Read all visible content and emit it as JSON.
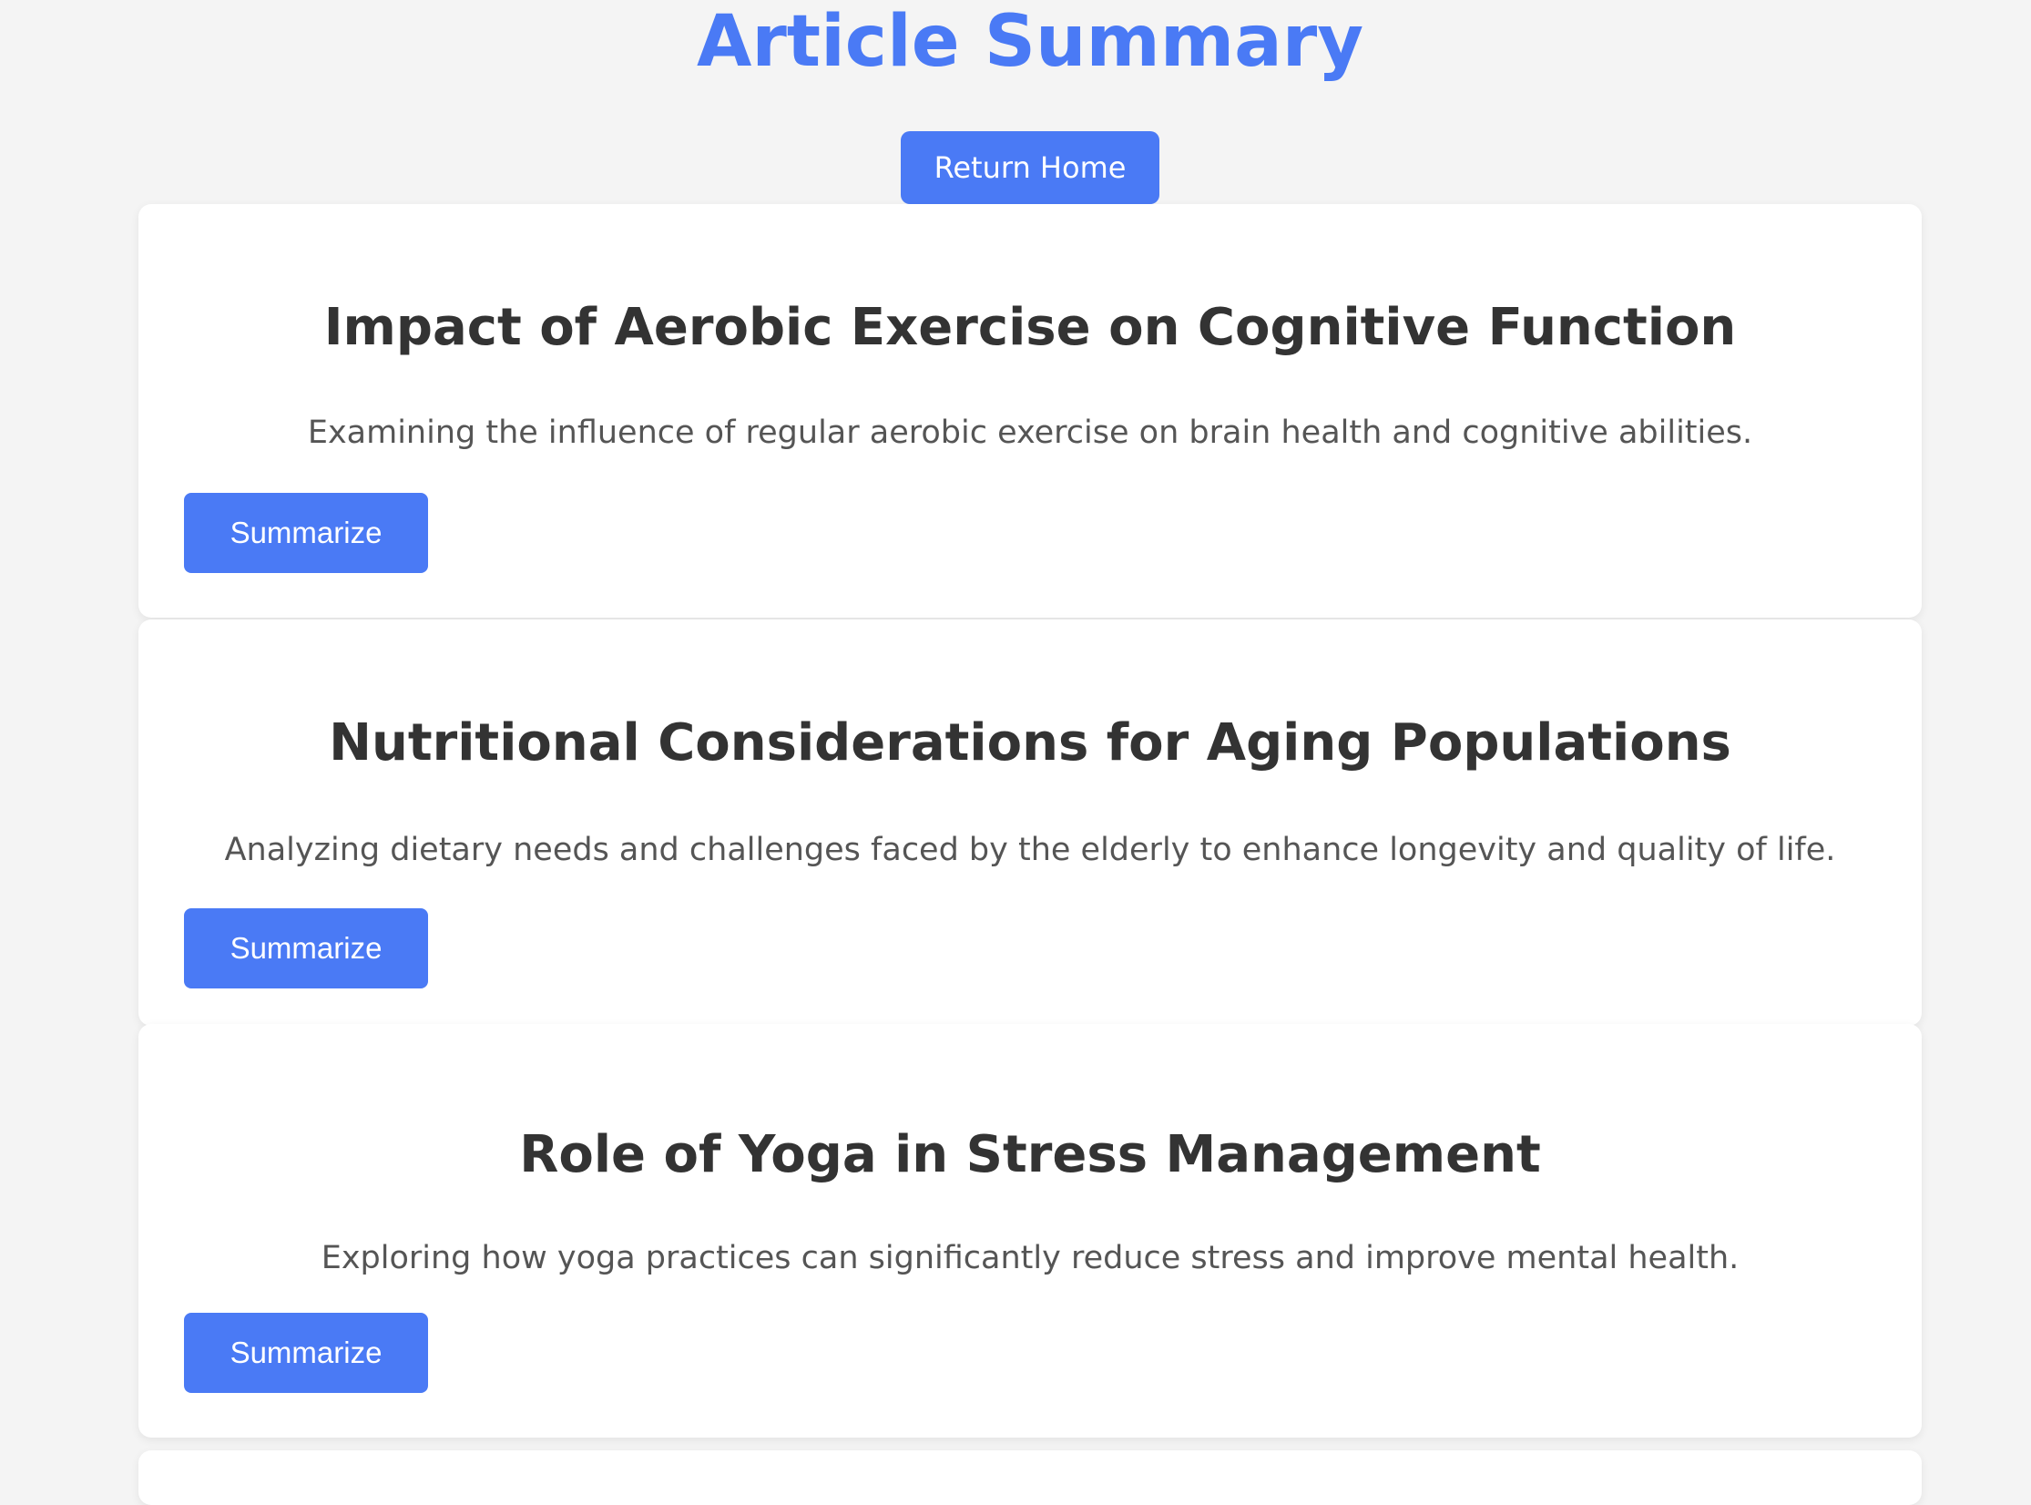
{
  "page": {
    "title": "Article Summary",
    "home_button_label": "Return Home"
  },
  "articles": [
    {
      "title": "Impact of Aerobic Exercise on Cognitive Function",
      "description": "Examining the influence of regular aerobic exercise on brain health and cognitive abilities.",
      "button_label": "Summarize"
    },
    {
      "title": "Nutritional Considerations for Aging Populations",
      "description": "Analyzing dietary needs and challenges faced by the elderly to enhance longevity and quality of life.",
      "button_label": "Summarize"
    },
    {
      "title": "Role of Yoga in Stress Management",
      "description": "Exploring how yoga practices can significantly reduce stress and improve mental health.",
      "button_label": "Summarize"
    }
  ],
  "colors": {
    "accent": "#4a7af5",
    "background": "#f4f4f4",
    "card": "#ffffff",
    "title_text": "#333333",
    "body_text": "#555555"
  }
}
